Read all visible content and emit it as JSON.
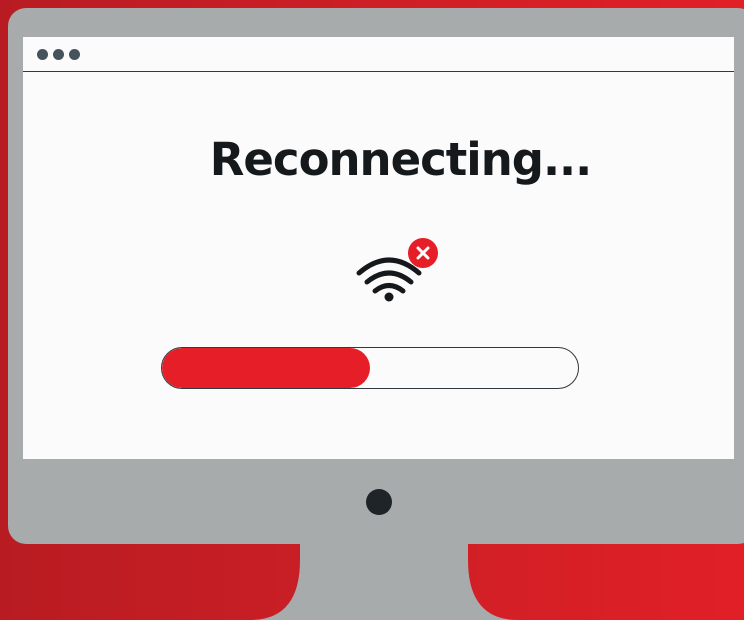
{
  "window": {
    "title_bar_icon": "window-dots-icon"
  },
  "main": {
    "heading": "Reconnecting...",
    "wifi_icon": "wifi-icon",
    "error_icon": "close-icon"
  },
  "progress": {
    "fraction": 0.5
  },
  "colors": {
    "accent": "#e61e27",
    "screen": "#fbfbfb",
    "frame": "#a7abac",
    "dark": "#15191b"
  }
}
